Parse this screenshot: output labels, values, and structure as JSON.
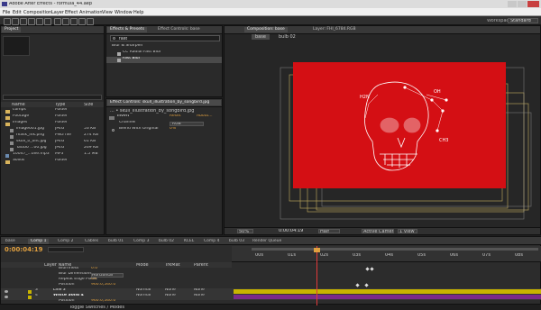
{
  "window": {
    "title": "Adobe After Effects - formula_44.aep"
  },
  "menu": [
    "File",
    "Edit",
    "Composition",
    "Layer",
    "Effect",
    "Animation",
    "View",
    "Window",
    "Help"
  ],
  "workspace": {
    "label": "Workspace:",
    "value": "Standard"
  },
  "project": {
    "tab": "Project",
    "columns": {
      "name": "Name",
      "type": "Type",
      "size": "Size"
    },
    "items": [
      {
        "name": "comps",
        "type": "Folder",
        "size": ""
      },
      {
        "name": "Footage",
        "type": "Folder",
        "size": ""
      },
      {
        "name": "images",
        "type": "Folder",
        "size": ""
      },
      {
        "name": "image001.jpg",
        "type": "JPEG",
        "size": "53 KB"
      },
      {
        "name": "mask_ink.png",
        "type": "PNG file",
        "size": "274 KB"
      },
      {
        "name": "skull_ti_ont.jpg",
        "type": "JPEG",
        "size": "61 KB"
      },
      {
        "name": "Tattoo ...00.jpg",
        "type": "JPEG",
        "size": "269 KB"
      },
      {
        "name": "10047_...ove.mp3",
        "type": "MP3",
        "size": "1.5 MB"
      },
      {
        "name": "Solids",
        "type": "Folder",
        "size": ""
      }
    ]
  },
  "effects": {
    "tab": "Effects & Presets",
    "tab2": "Effect Controls: base",
    "search": "fast",
    "category": "Blur & Sharpen",
    "items": [
      "CC Radial Fast Blur",
      "Fast Blur"
    ]
  },
  "effect_controls": {
    "tab": "Effect Controls: skull_illustration_by_songbird.jpg",
    "path": "... • skull_illustration_by_songbird.jpg",
    "effect": "Invert",
    "reset": "Reset",
    "about": "About...",
    "channel_label": "Channel",
    "channel_value": "RGB",
    "blend_label": "Blend With Original",
    "blend_value": "0%"
  },
  "composition": {
    "tab": "Composition: base",
    "layer_tab": "Layer: FHI_6784.RGB",
    "sub_tabs": [
      "base",
      "bulb 02"
    ],
    "bottom": {
      "zoom": "50%",
      "time": "0:00:04:19",
      "quality": "Half",
      "camera": "Active Camera",
      "view": "1 View"
    },
    "annotations": [
      "H2N",
      "OH",
      "CH3"
    ]
  },
  "timeline": {
    "tabs": [
      "base",
      "Comp 1",
      "Comp 2",
      "Cables",
      "bulb 01",
      "Comp 3",
      "bulb 02",
      "KCEL",
      "Comp 4",
      "bulb 03",
      "Render Queue"
    ],
    "timecode": "0:00:04:19",
    "rulers": [
      "00s",
      "01s",
      "02s",
      "03s",
      "04s",
      "05s",
      "06s",
      "07s",
      "08s"
    ],
    "header": {
      "layer_name": "Layer Name",
      "mode": "Mode",
      "trkmat": "TrkMat",
      "parent": "Parent"
    },
    "rows": [
      {
        "name": "Blurriness",
        "value": "0.0"
      },
      {
        "name": "Blur Dimensions",
        "value": "Horizontal"
      },
      {
        "name": "Repeat Edge Pixels",
        "value": "Off"
      },
      {
        "name": "Position",
        "value": "960.0,540.0"
      },
      {
        "num": "3",
        "name": "Line 3",
        "mode": "Normal",
        "trkmat": "None",
        "parent": "None"
      },
      {
        "num": "4",
        "name": "White Solid 4",
        "mode": "Normal",
        "trkmat": "None",
        "parent": "None"
      },
      {
        "name": "Position",
        "value": "960.0,540.0"
      }
    ],
    "toggle": "Toggle Switches / Modes"
  },
  "colors": {
    "accent": "#d40f14",
    "orange": "#e0a040",
    "purple": "#7a2a8a",
    "yellow": "#c8b400"
  }
}
